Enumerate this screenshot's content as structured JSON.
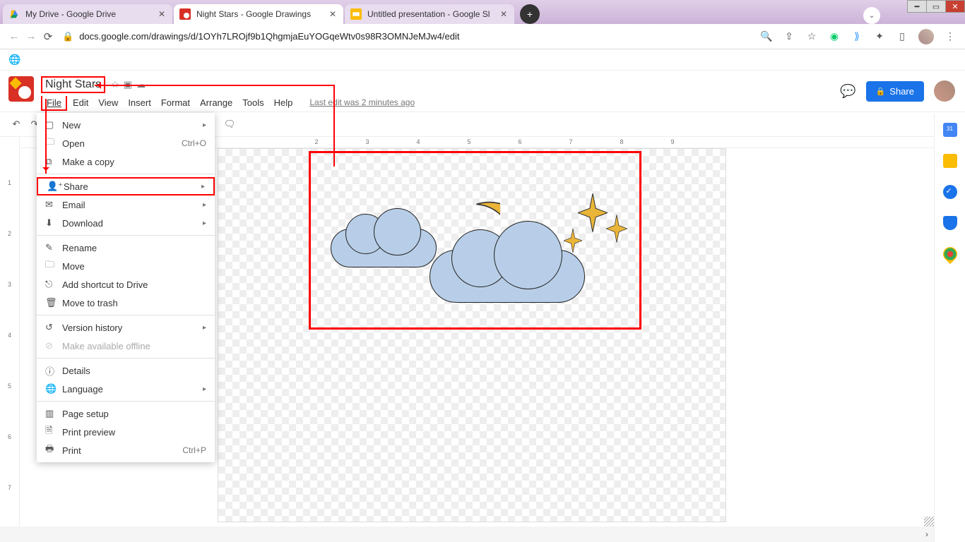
{
  "browser": {
    "tabs": [
      {
        "title": "My Drive - Google Drive",
        "favicon": "drive"
      },
      {
        "title": "Night Stars - Google Drawings",
        "favicon": "drawings"
      },
      {
        "title": "Untitled presentation - Google Sl",
        "favicon": "slides"
      }
    ],
    "url": "docs.google.com/drawings/d/1OYh7LROjf9b1QhgmjaEuYOGqeWtv0s98R3OMNJeMJw4/edit"
  },
  "document": {
    "title": "Night Stars",
    "last_edit": "Last edit was 2 minutes ago",
    "menubar": [
      "File",
      "Edit",
      "View",
      "Insert",
      "Format",
      "Arrange",
      "Tools",
      "Help"
    ]
  },
  "share_button": "Share",
  "file_menu": {
    "new": "New",
    "open": "Open",
    "open_short": "Ctrl+O",
    "make_copy": "Make a copy",
    "share": "Share",
    "email": "Email",
    "download": "Download",
    "rename": "Rename",
    "move": "Move",
    "add_shortcut": "Add shortcut to Drive",
    "move_trash": "Move to trash",
    "version_history": "Version history",
    "offline": "Make available offline",
    "details": "Details",
    "language": "Language",
    "page_setup": "Page setup",
    "print_preview": "Print preview",
    "print": "Print",
    "print_short": "Ctrl+P"
  },
  "ruler_h": [
    "2",
    "3",
    "4",
    "5",
    "6",
    "7",
    "8",
    "9"
  ],
  "ruler_v": [
    "1",
    "2",
    "3",
    "4",
    "5",
    "6",
    "7"
  ],
  "side_panel": [
    "calendar",
    "keep",
    "tasks",
    "contacts",
    "maps"
  ]
}
